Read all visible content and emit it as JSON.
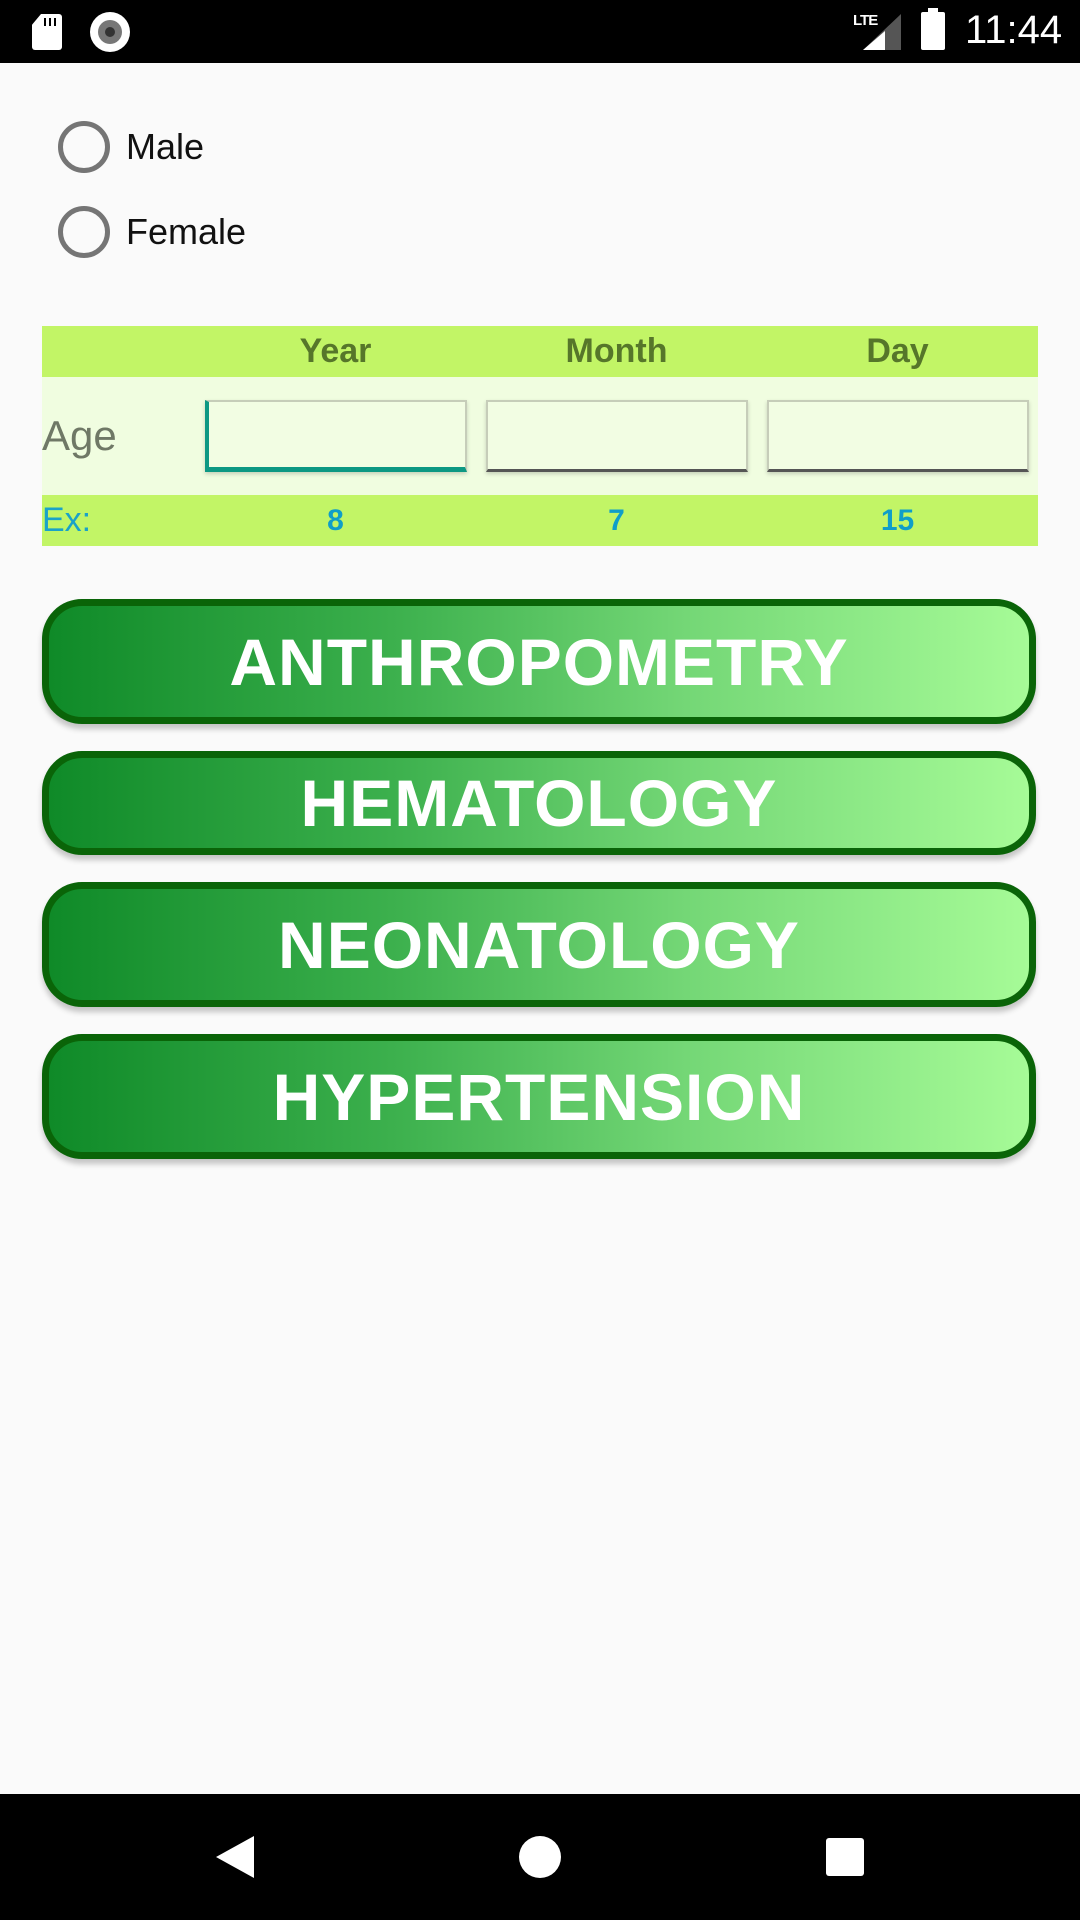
{
  "status_bar": {
    "network_label": "LTE",
    "time": "11:44",
    "icons": [
      "sd-card-icon",
      "screen-record-icon",
      "lte-signal-icon",
      "battery-icon"
    ]
  },
  "gender": {
    "options": [
      {
        "label": "Male",
        "selected": false
      },
      {
        "label": "Female",
        "selected": false
      }
    ]
  },
  "age_table": {
    "columns": [
      "Year",
      "Month",
      "Day"
    ],
    "row_label": "Age",
    "inputs": [
      {
        "value": "",
        "focused": true
      },
      {
        "value": "",
        "focused": false
      },
      {
        "value": "",
        "focused": false
      }
    ],
    "example_label": "Ex:",
    "example_values": [
      "8",
      "7",
      "15"
    ]
  },
  "categories": [
    {
      "label": "ANTHROPOMETRY"
    },
    {
      "label": "HEMATOLOGY"
    },
    {
      "label": "NEONATOLOGY"
    },
    {
      "label": "HYPERTENSION"
    }
  ],
  "colors": {
    "header_bg": "#c2f566",
    "header_text": "#56762a",
    "example_text": "#0f9ec8",
    "focus_accent": "#0d9883",
    "button_border": "#0a6408",
    "button_gradient_start": "#0f8a28",
    "button_gradient_end": "#a6fb97"
  },
  "nav_bar": {
    "buttons": [
      "back",
      "home",
      "recents"
    ]
  }
}
